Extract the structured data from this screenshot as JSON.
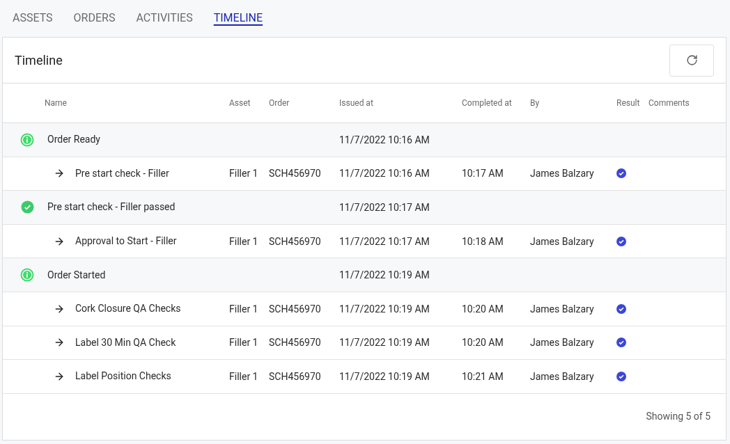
{
  "tabs": [
    {
      "label": "ASSETS",
      "selected": false
    },
    {
      "label": "ORDERS",
      "selected": false
    },
    {
      "label": "ACTIVITIES",
      "selected": false
    },
    {
      "label": "TIMELINE",
      "selected": true
    }
  ],
  "panel": {
    "title": "Timeline"
  },
  "table": {
    "columns": [
      "Name",
      "Asset",
      "Order",
      "Issued at",
      "Completed at",
      "By",
      "Result",
      "Comments"
    ],
    "rows": [
      {
        "kind": "info",
        "name": "Order Ready",
        "issued_at": "11/7/2022 10:16 AM"
      },
      {
        "kind": "step",
        "name": "Pre start check - Filler",
        "asset": "Filler 1",
        "order": "SCH456970",
        "issued_at": "11/7/2022 10:16 AM",
        "completed_at": "10:17 AM",
        "by": "James Balzary",
        "passed": true
      },
      {
        "kind": "passed",
        "name": "Pre start check - Filler passed",
        "issued_at": "11/7/2022 10:17 AM"
      },
      {
        "kind": "step",
        "name": "Approval to Start - Filler",
        "asset": "Filler 1",
        "order": "SCH456970",
        "issued_at": "11/7/2022 10:17 AM",
        "completed_at": "10:18 AM",
        "by": "James Balzary",
        "passed": true
      },
      {
        "kind": "info",
        "name": "Order Started",
        "issued_at": "11/7/2022 10:19 AM"
      },
      {
        "kind": "step",
        "name": "Cork Closure QA Checks",
        "asset": "Filler 1",
        "order": "SCH456970",
        "issued_at": "11/7/2022 10:19 AM",
        "completed_at": "10:20 AM",
        "by": "James Balzary",
        "passed": true
      },
      {
        "kind": "step",
        "name": "Label 30 Min QA Check",
        "asset": "Filler 1",
        "order": "SCH456970",
        "issued_at": "11/7/2022 10:19 AM",
        "completed_at": "10:20 AM",
        "by": "James Balzary",
        "passed": true
      },
      {
        "kind": "step",
        "name": "Label Position Checks",
        "asset": "Filler 1",
        "order": "SCH456970",
        "issued_at": "11/7/2022 10:19 AM",
        "completed_at": "10:21 AM",
        "by": "James Balzary",
        "passed": true
      }
    ]
  },
  "footer": {
    "summary": "Showing 5 of 5"
  }
}
